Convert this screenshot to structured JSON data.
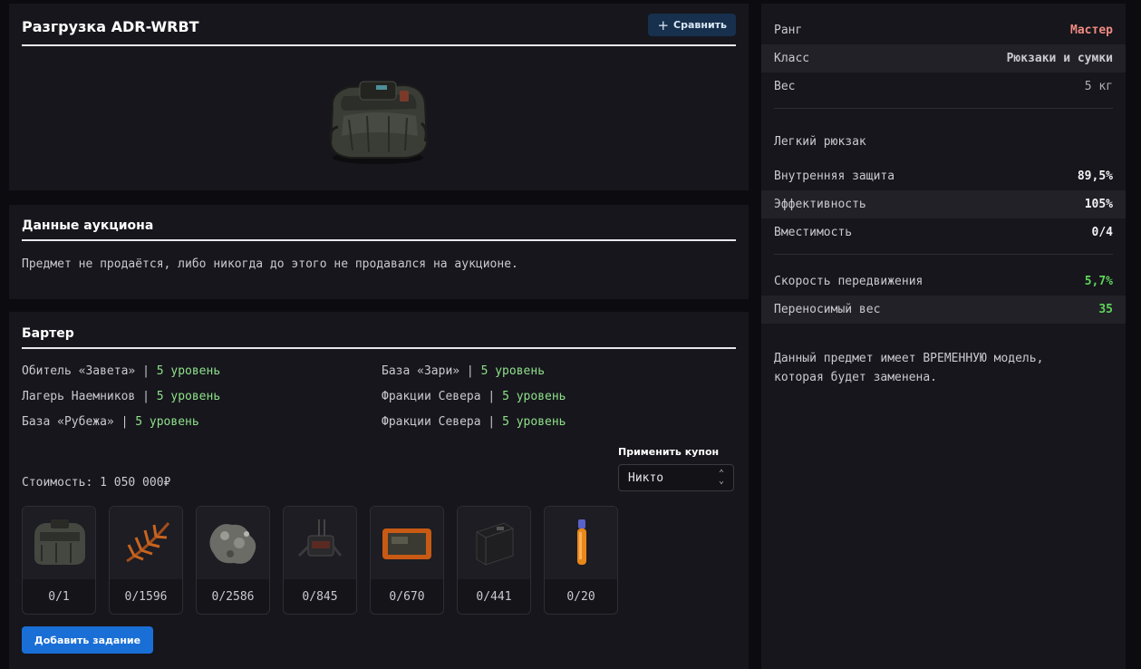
{
  "item": {
    "title": "Разгрузка ADR-WRBT",
    "compare_label": "Сравнить"
  },
  "auction": {
    "title": "Данные аукциона",
    "text": "Предмет не продаётся, либо никогда до этого не продавался на аукционе."
  },
  "barter": {
    "title": "Бартер",
    "separator": "|",
    "vendors": [
      {
        "name": "Обитель «Завета»",
        "level": "5 уровень"
      },
      {
        "name": "База «Зари»",
        "level": "5 уровень"
      },
      {
        "name": "Лагерь Наемников",
        "level": "5 уровень"
      },
      {
        "name": "Фракции Севера",
        "level": "5 уровень"
      },
      {
        "name": "База «Рубежа»",
        "level": "5 уровень"
      },
      {
        "name": "Фракции Севера",
        "level": "5 уровень"
      }
    ],
    "coupon_label": "Применить купон",
    "coupon_value": "Никто",
    "cost": "Стоимость: 1 050 000₽",
    "materials": [
      {
        "icon": "backpack-icon",
        "count": "0/1"
      },
      {
        "icon": "fern-icon",
        "count": "0/1596"
      },
      {
        "icon": "ore-icon",
        "count": "0/2586"
      },
      {
        "icon": "device-icon",
        "count": "0/845"
      },
      {
        "icon": "tablet-icon",
        "count": "0/670"
      },
      {
        "icon": "battery-icon",
        "count": "0/441"
      },
      {
        "icon": "vial-icon",
        "count": "0/20"
      }
    ],
    "add_task_label": "Добавить задание"
  },
  "stats": {
    "rank_label": "Ранг",
    "rank_value": "Мастер",
    "class_label": "Класс",
    "class_value": "Рюкзаки и сумки",
    "weight_label": "Вес",
    "weight_value": "5 кг",
    "note": "Легкий рюкзак",
    "protection_label": "Внутренняя защита",
    "protection_value": "89,5%",
    "efficiency_label": "Эффективность",
    "efficiency_value": "105%",
    "capacity_label": "Вместимость",
    "capacity_value": "0/4",
    "speed_label": "Скорость передвижения",
    "speed_value": "5,7%",
    "carry_label": "Переносимый вес",
    "carry_value": "35",
    "description": "Данный предмет имеет ВРЕМЕННУЮ модель, которая будет заменена."
  },
  "colors": {
    "accent_blue": "#1a6fd6",
    "rank_red": "#f08a82",
    "level_green": "#8fe08a",
    "bonus_green": "#5fd35a"
  }
}
